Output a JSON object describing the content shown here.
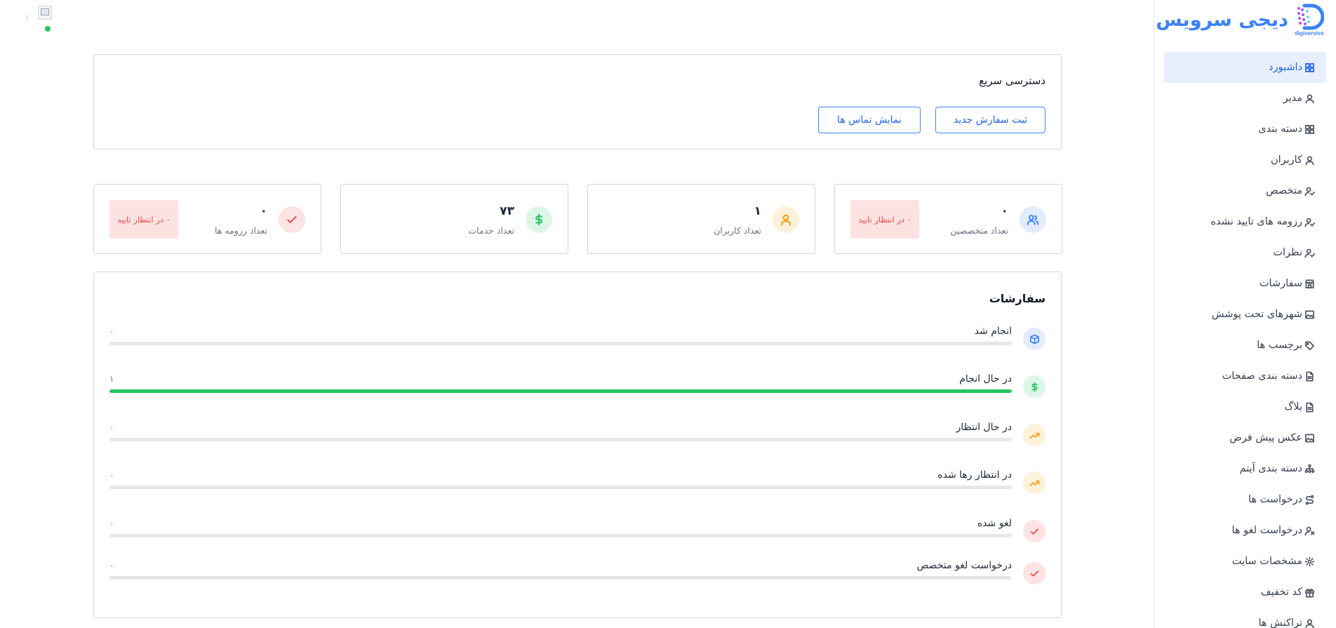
{
  "brand": {
    "name": "دیجی سرویس",
    "logo_text": "digiservice",
    "color": "#3b82f6"
  },
  "sidebar": {
    "items": [
      {
        "label": "داشبورد",
        "icon": "grid-icon",
        "active": true
      },
      {
        "label": "مدیر",
        "icon": "user-icon"
      },
      {
        "label": "دسته بندی",
        "icon": "grid-icon"
      },
      {
        "label": "کاربران",
        "icon": "user-icon"
      },
      {
        "label": "متخصص",
        "icon": "user-check-icon"
      },
      {
        "label": "رزومه های تایید نشده",
        "icon": "user-check-icon"
      },
      {
        "label": "نظرات",
        "icon": "user-check-icon"
      },
      {
        "label": "سفارشات",
        "icon": "store-icon"
      },
      {
        "label": "شهرهای تحت پوشش",
        "icon": "image-icon"
      },
      {
        "label": "برچسب ها",
        "icon": "tag-icon"
      },
      {
        "label": "دسته بندی صفحات",
        "icon": "file-icon"
      },
      {
        "label": "بلاگ",
        "icon": "file-icon"
      },
      {
        "label": "عکس پیش فرض",
        "icon": "image-icon"
      },
      {
        "label": "دسته بندی آیتم",
        "icon": "sitemap-icon"
      },
      {
        "label": "درخواست ها",
        "icon": "route-icon"
      },
      {
        "label": "درخواست لغو ها",
        "icon": "user-x-icon"
      },
      {
        "label": "مشخصات سایت",
        "icon": "gear-icon"
      },
      {
        "label": "کد تخفیف",
        "icon": "gift-icon"
      },
      {
        "label": "تراکنش ها",
        "icon": "user-icon"
      }
    ]
  },
  "quick_access": {
    "title": "دسترسی سریع",
    "new_order_label": "ثبت سفارش جدید",
    "contacts_label": "نمایش تماس ها"
  },
  "stats": [
    {
      "label": "تعداد متخصصین",
      "value": "۰",
      "icon": "users-icon",
      "pending": "۰ در انتظار تایید",
      "color": "#3b82f6"
    },
    {
      "label": "تعداد کاربران",
      "value": "۱",
      "icon": "user-icon",
      "pending": "",
      "color": "#f59e0b"
    },
    {
      "label": "تعداد خدمات",
      "value": "۷۳",
      "icon": "dollar-icon",
      "pending": "",
      "color": "#22c55e"
    },
    {
      "label": "تعداد رزومه ها",
      "value": "۰",
      "icon": "check-icon",
      "pending": "۰ در انتظار تایید",
      "color": "#ef4444"
    }
  ],
  "orders": {
    "title": "سفارشات",
    "rows": [
      {
        "label": "انجام شد",
        "count": "۰",
        "progress": 0,
        "icon": "box-icon",
        "color": "#3b82f6"
      },
      {
        "label": "در حال انجام",
        "count": "۱",
        "progress": 1,
        "icon": "dollar-icon",
        "color": "#22c55e"
      },
      {
        "label": "در حال انتظار",
        "count": "۰",
        "progress": 0,
        "icon": "trend-icon",
        "color": "#f59e0b"
      },
      {
        "label": "در انتظار رها شده",
        "count": "۰",
        "progress": 0,
        "icon": "trend-icon",
        "color": "#f59e0b"
      },
      {
        "label": "لغو شده",
        "count": "۰",
        "progress": 0,
        "icon": "check-icon",
        "color": "#ef4444"
      },
      {
        "label": "درخواست لغو متخصص",
        "count": "۰",
        "progress": 0,
        "icon": "check-icon",
        "color": "#ef4444"
      }
    ]
  }
}
